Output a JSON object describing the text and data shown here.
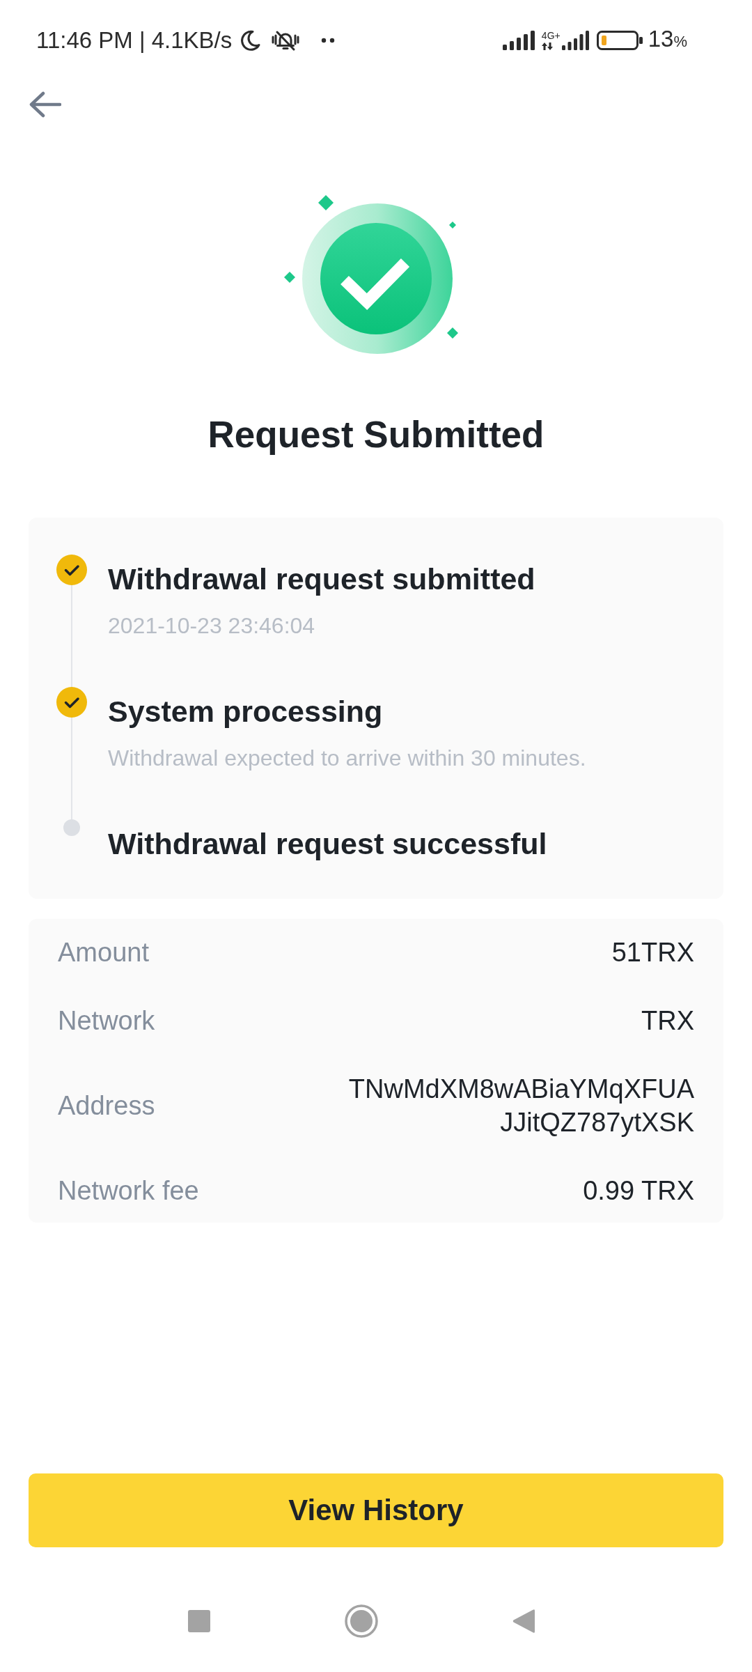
{
  "status_bar": {
    "text": "11:46 PM | 4.1KB/s",
    "network_type": "4G+",
    "battery_value": "13",
    "battery_unit": "%"
  },
  "result": {
    "title": "Request Submitted"
  },
  "steps": [
    {
      "title": "Withdrawal request submitted",
      "detail": "2021-10-23 23:46:04",
      "done": true
    },
    {
      "title": "System processing",
      "detail": "Withdrawal expected to arrive within 30 minutes.",
      "done": true
    },
    {
      "title": "Withdrawal request successful",
      "done": false
    }
  ],
  "details": [
    {
      "label": "Amount",
      "value": "51TRX"
    },
    {
      "label": "Network",
      "value": "TRX"
    },
    {
      "label": "Address",
      "value": "TNwMdXM8wABiaYMqXFUAJJitQZ787ytXSK"
    },
    {
      "label": "Network fee",
      "value": "0.99 TRX"
    }
  ],
  "primary_button": {
    "label": "View History"
  }
}
